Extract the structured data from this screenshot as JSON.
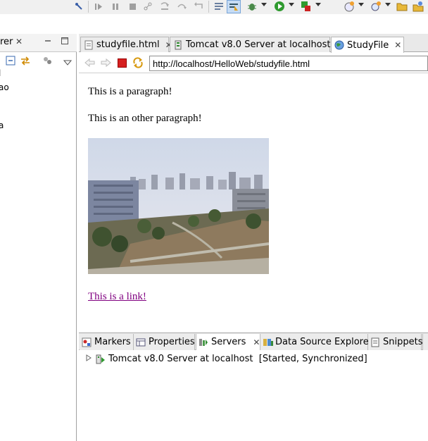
{
  "toolbar": {
    "icons": [
      "pin-icon",
      "skip-all-breakpoints-icon",
      "resume-icon",
      "suspend-icon",
      "terminate-icon",
      "disconnect-icon",
      "step-into-icon",
      "step-over-icon",
      "step-return-icon",
      "drop-to-frame-icon",
      "use-step-filters-icon",
      "debug-icon",
      "run-icon",
      "external-tools-icon",
      "new-server-icon",
      "search-icon",
      "open-folder-icon",
      "open-type-icon"
    ]
  },
  "left_view": {
    "tab_label": "rer",
    "close_glyph": "✕",
    "tree_items": [
      "l",
      "ao",
      "",
      "a"
    ]
  },
  "editor": {
    "tabs": [
      {
        "label": "studyfile.html",
        "icon": "html-file-icon",
        "close": "✕"
      },
      {
        "label": "Tomcat v8.0 Server at localhost",
        "icon": "server-config-icon",
        "close": ""
      },
      {
        "label": "StudyFile",
        "icon": "globe-icon",
        "close": "✕"
      }
    ],
    "url": "http://localhost/HelloWeb/studyfile.html"
  },
  "page": {
    "paragraph1": "This is a paragraph!",
    "paragraph2": "This is an other paragraph!",
    "image_alt": "campus photo",
    "link_text": "This is a link!",
    "link_color": "#800080"
  },
  "bottom_panel": {
    "tabs": [
      {
        "label": "Markers",
        "icon": "markers-icon"
      },
      {
        "label": "Properties",
        "icon": "properties-icon"
      },
      {
        "label": "Servers",
        "icon": "servers-icon",
        "close": "✕"
      },
      {
        "label": "Data Source Explorer",
        "icon": "data-source-icon"
      },
      {
        "label": "Snippets",
        "icon": "snippets-icon"
      }
    ],
    "server_entry": "Tomcat v8.0 Server at localhost  [Started, Synchronized]"
  }
}
